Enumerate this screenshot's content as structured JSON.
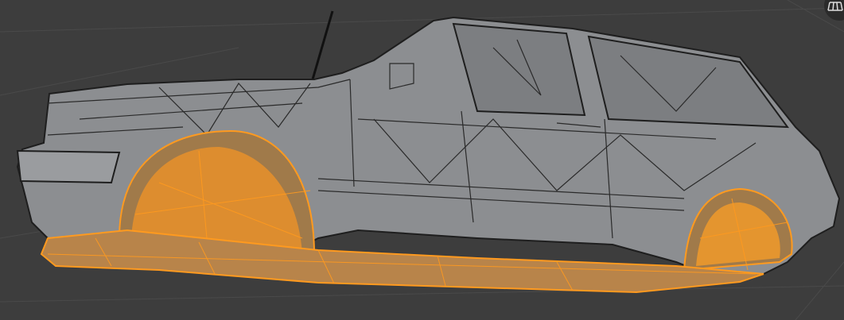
{
  "viewport": {
    "background_color": "#3d3d3d",
    "mesh_color": "#8c8e91",
    "wire_color": "#1e1e1e",
    "selection_color": "#ff9a1f"
  },
  "icons": {
    "toggle_view": "perspective-grid-icon"
  }
}
